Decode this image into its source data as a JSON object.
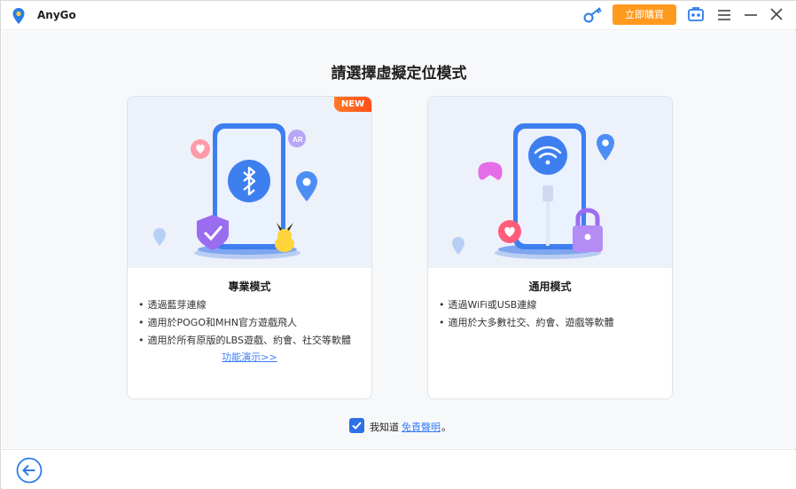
{
  "app": {
    "name": "AnyGo"
  },
  "titlebar": {
    "buy_label": "立即購買"
  },
  "main": {
    "title": "請選擇虛擬定位模式",
    "cards": [
      {
        "title": "專業模式",
        "badge": "NEW",
        "features": [
          "透過藍芽連線",
          "適用於POGO和MHN官方遊戲飛人",
          "適用於所有原版的LBS遊戲、約會、社交等軟體"
        ],
        "demo_link": "功能演示>>",
        "illustration_icon": "bluetooth-icon"
      },
      {
        "title": "通用模式",
        "features": [
          "透過WiFi或USB連線",
          "適用於大多數社交、約會、遊戲等軟體"
        ],
        "illustration_icon": "wifi-icon"
      }
    ],
    "agree": {
      "checked": true,
      "text": "我知道",
      "link": "免責聲明",
      "suffix": "。"
    }
  },
  "colors": {
    "accent": "#2d6fe8",
    "buy": "#ff9a1e",
    "link": "#3b7df5",
    "badge": "#ff5a1f"
  }
}
